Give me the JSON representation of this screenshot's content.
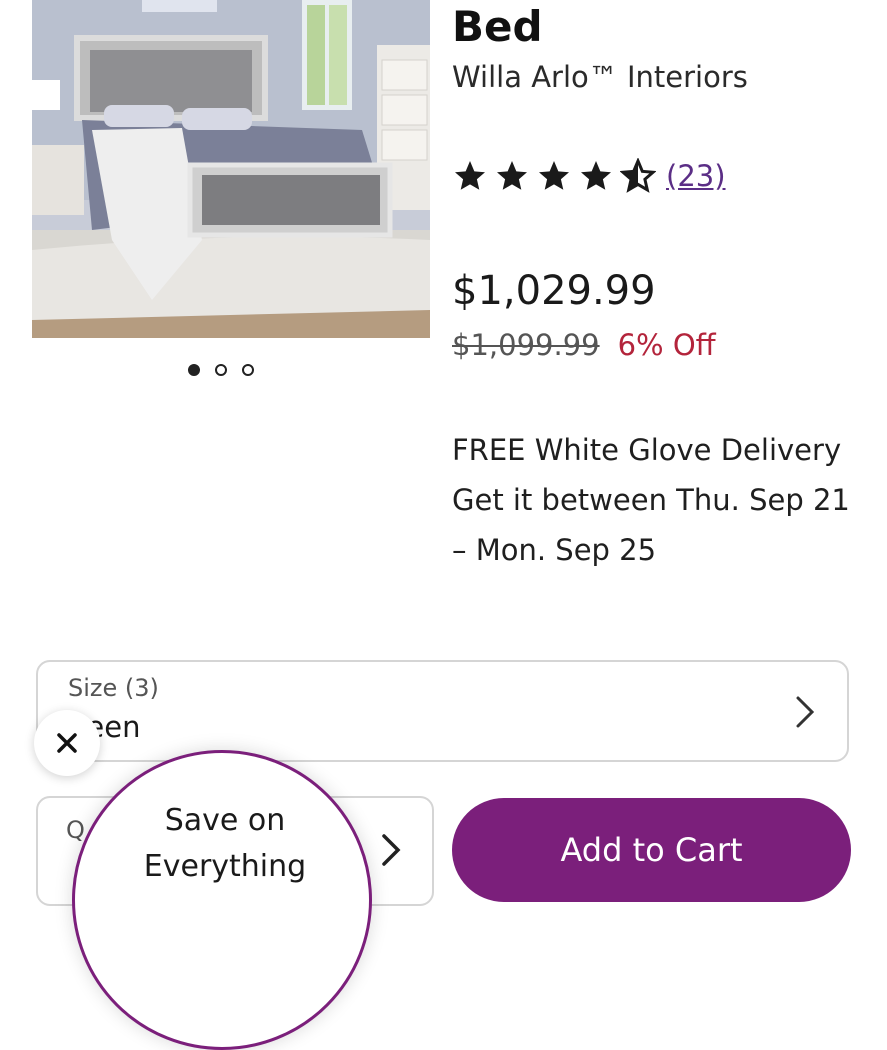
{
  "product": {
    "title": "Bed",
    "brand": "Willa Arlo™ Interiors",
    "rating": 4.5,
    "review_count": "(23)",
    "price": "$1,029.99",
    "old_price": "$1,099.99",
    "discount": "6% Off"
  },
  "gallery": {
    "image_count": 3,
    "active_index": 0
  },
  "delivery": {
    "line1": "FREE White Glove Delivery",
    "line2": "Get it between Thu. Sep 21",
    "line3": "– Mon. Sep 25"
  },
  "options": {
    "size_label": "Size (3)",
    "size_value": "ueen",
    "quantity_label": "Q"
  },
  "actions": {
    "add_to_cart": "Add to Cart"
  },
  "promo": {
    "line1": "Save on",
    "line2": "Everything"
  },
  "colors": {
    "brand_purple": "#7b1f7b",
    "discount_red": "#b3243b",
    "review_link": "#5b2e86"
  },
  "icons": [
    "star-icon",
    "half-star-icon",
    "chevron-right-icon",
    "close-icon"
  ]
}
